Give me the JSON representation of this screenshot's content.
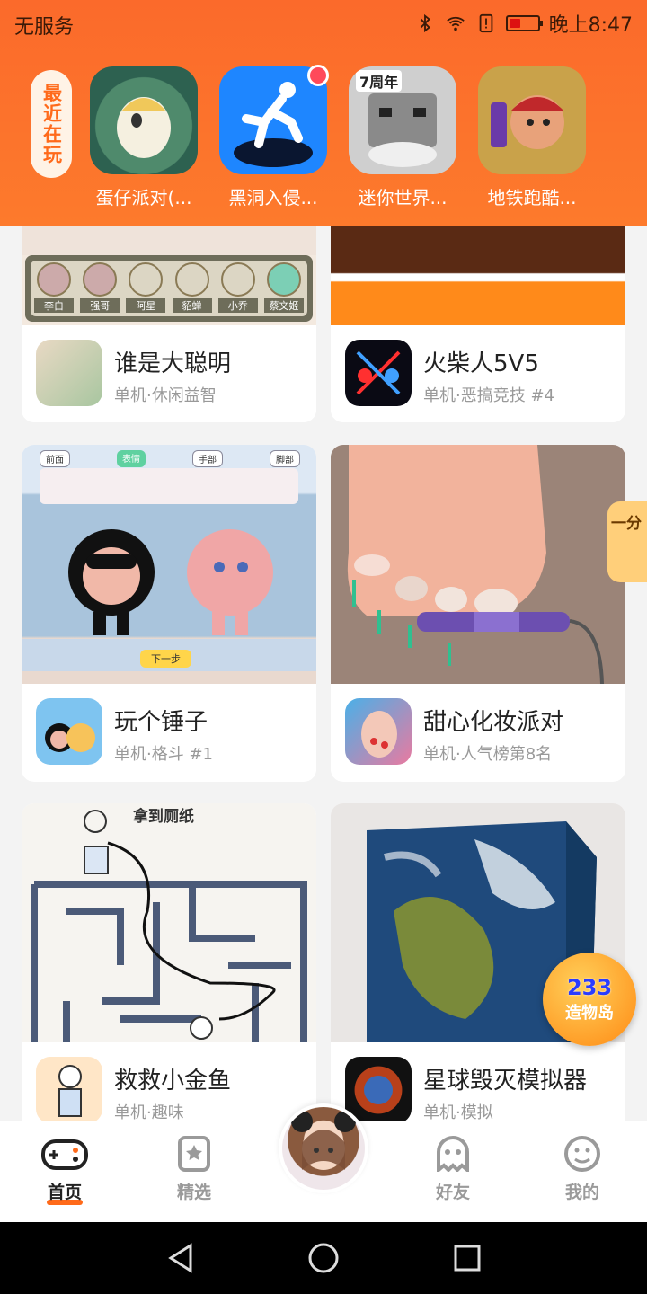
{
  "status_bar": {
    "carrier": "无服务",
    "time": "晚上8:47",
    "battery_level": 0.4,
    "icons": [
      "bluetooth-icon",
      "wifi-icon",
      "sim-alert-icon",
      "battery-icon"
    ]
  },
  "recent": {
    "label": "最近在玩",
    "games": [
      {
        "name": "蛋仔派对(...",
        "icon": "egg-party-icon",
        "badge": false
      },
      {
        "name": "黑洞入侵...",
        "icon": "black-hole-icon",
        "badge": true
      },
      {
        "name": "迷你世界...",
        "icon": "mini-world-icon",
        "badge": false
      },
      {
        "name": "地铁跑酷...",
        "icon": "subway-surfers-icon",
        "badge": false
      }
    ]
  },
  "feed": {
    "cards": [
      {
        "name": "谁是大聪明",
        "sub": "单机·休闲益智"
      },
      {
        "name": "火柴人5V5",
        "sub": "单机·恶搞竞技 #4"
      },
      {
        "name": "玩个锤子",
        "sub": "单机·格斗 #1"
      },
      {
        "name": "甜心化妆派对",
        "sub": "单机·人气榜第8名"
      },
      {
        "name": "救救小金鱼",
        "sub": "单机·趣味"
      },
      {
        "name": "星球毁灭模拟器",
        "sub": "单机·模拟"
      }
    ],
    "thumb_texts": {
      "card1_names": [
        "李白",
        "强哥",
        "阿星",
        "貂蝉",
        "小乔",
        "蔡文姬"
      ],
      "card3_tabs": [
        "前面",
        "表情",
        "手部",
        "脚部"
      ],
      "card3_button": "下一步",
      "card5_caption": "拿到厕纸",
      "recent_game3_badge": "7周年"
    }
  },
  "float_badge": {
    "number": "233",
    "text": "造物岛"
  },
  "float_right_text": "一分",
  "nav": {
    "items": [
      {
        "label": "首页",
        "icon": "gamepad-icon",
        "active": true
      },
      {
        "label": "精选",
        "icon": "star-bookmark-icon",
        "active": false
      },
      {
        "label": "好友",
        "icon": "ghost-icon",
        "active": false
      },
      {
        "label": "我的",
        "icon": "smiley-icon",
        "active": false
      }
    ]
  },
  "colors": {
    "accent": "#fd7a2c",
    "nav_active": "#ff6a1a"
  }
}
